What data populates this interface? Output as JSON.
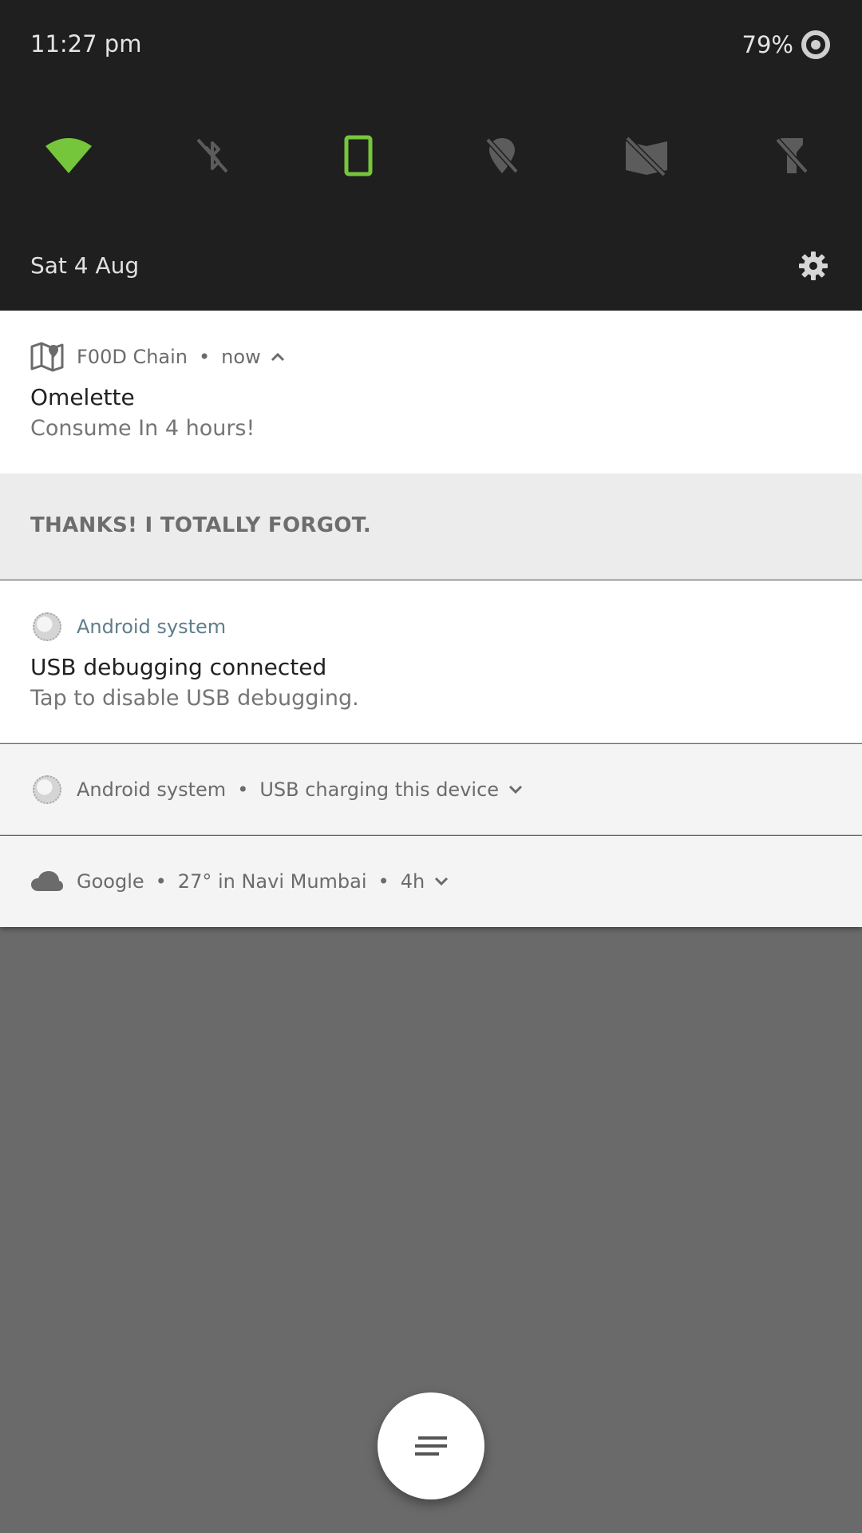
{
  "status_bar": {
    "time": "11:27 pm",
    "battery_percent": "79%"
  },
  "quick_settings": {
    "tiles": [
      {
        "name": "wifi-icon",
        "state": "on",
        "color": "#76c63b"
      },
      {
        "name": "bluetooth-off-icon",
        "state": "off",
        "color": "#5c5c5c"
      },
      {
        "name": "phone-portrait-icon",
        "state": "on",
        "color": "#76c63b"
      },
      {
        "name": "location-off-icon",
        "state": "off",
        "color": "#5c5c5c"
      },
      {
        "name": "do-not-disturb-off-icon",
        "state": "off",
        "color": "#5c5c5c"
      },
      {
        "name": "flashlight-off-icon",
        "state": "off",
        "color": "#5c5c5c"
      }
    ],
    "date": "Sat 4 Aug"
  },
  "notifications": {
    "food": {
      "app": "F00D Chain",
      "time": "now",
      "title": "Omelette",
      "text": "Consume In 4 hours!",
      "action": "THANKS! I TOTALLY FORGOT."
    },
    "usb_debug": {
      "app": "Android system",
      "title": "USB debugging connected",
      "text": "Tap to disable USB debugging."
    },
    "usb_charging": {
      "app": "Android system",
      "summary": "USB charging this device"
    },
    "google": {
      "app": "Google",
      "summary": "27° in Navi Mumbai",
      "time": "4h"
    }
  },
  "colors": {
    "accent_green": "#76c63b",
    "panel_dark": "#1f1f1f",
    "scrim": "#6a6a6a"
  }
}
